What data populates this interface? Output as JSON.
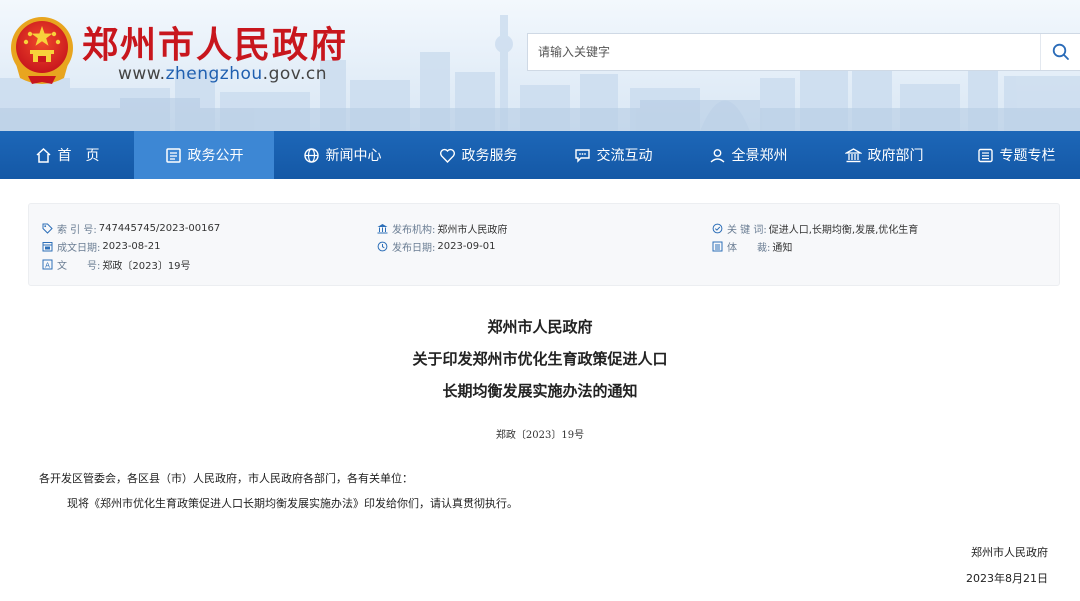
{
  "header": {
    "site_name": "郑州市人民政府",
    "url_prefix": "www.",
    "url_accent": "zhengzhou",
    "url_suffix": ".gov.cn",
    "search": {
      "placeholder": "请输入关键字",
      "icon": "search-icon"
    }
  },
  "nav": {
    "items": [
      {
        "label": "首　页",
        "icon": "home-icon"
      },
      {
        "label": "政务公开",
        "icon": "document-icon",
        "active": true
      },
      {
        "label": "新闻中心",
        "icon": "globe-icon"
      },
      {
        "label": "政务服务",
        "icon": "heart-icon"
      },
      {
        "label": "交流互动",
        "icon": "chat-icon"
      },
      {
        "label": "全景郑州",
        "icon": "panorama-icon"
      },
      {
        "label": "政府部门",
        "icon": "building-icon"
      },
      {
        "label": "专题专栏",
        "icon": "list-icon"
      }
    ]
  },
  "meta": {
    "index_label": "索 引 号:",
    "index_value": "747445745/2023-00167",
    "created_label": "成文日期:",
    "created_value": "2023-08-21",
    "docno_label": "文　　号:",
    "docno_value": "郑政〔2023〕19号",
    "issuer_label": "发布机构:",
    "issuer_value": "郑州市人民政府",
    "published_label": "发布日期:",
    "published_value": "2023-09-01",
    "keywords_label": "关 键 词:",
    "keywords_value": "促进人口,长期均衡,发展,优化生育",
    "genre_label": "体　　裁:",
    "genre_value": "通知"
  },
  "document": {
    "title_line1": "郑州市人民政府",
    "title_line2": "关于印发郑州市优化生育政策促进人口",
    "title_line3": "长期均衡发展实施办法的通知",
    "number": "郑政〔2023〕19号",
    "addressees": "各开发区管委会，各区县（市）人民政府，市人民政府各部门，各有关单位：",
    "body": "现将《郑州市优化生育政策促进人口长期均衡发展实施办法》印发给你们，请认真贯彻执行。",
    "signature": "郑州市人民政府",
    "date": "2023年8月21日"
  },
  "colors": {
    "brand_red": "#c8161d",
    "nav_blue": "#1a61b0",
    "nav_active": "#3d87d4",
    "meta_label": "#6a7d93"
  }
}
